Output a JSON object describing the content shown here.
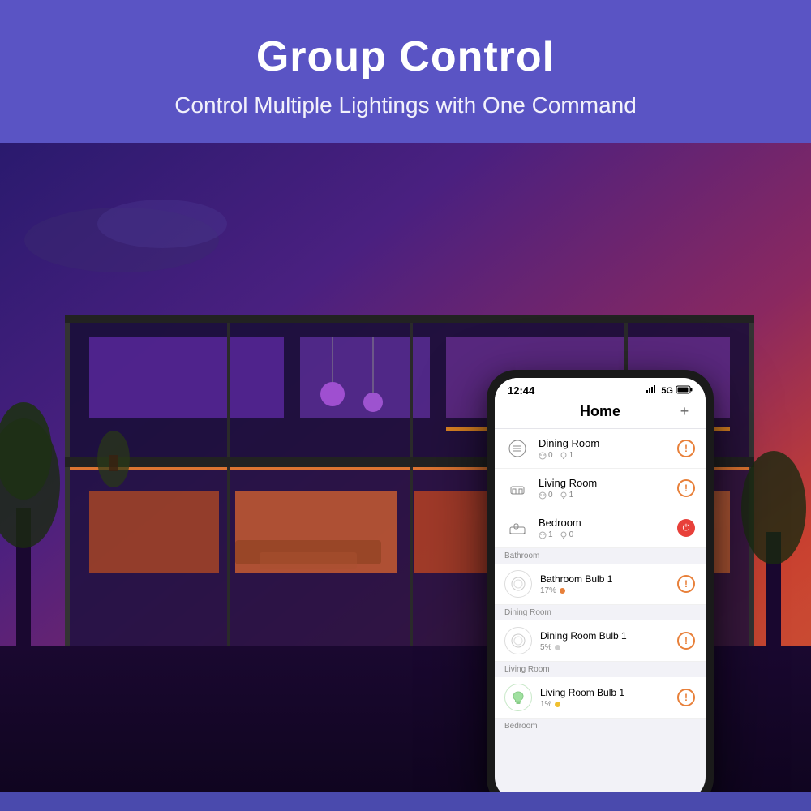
{
  "header": {
    "title": "Group Control",
    "subtitle": "Control Multiple Lightings with One Command"
  },
  "phone": {
    "status_bar": {
      "time": "12:44",
      "signal": "▪▪▪",
      "network": "5G",
      "battery": "▮"
    },
    "app_title": "Home",
    "add_button": "+",
    "rooms": [
      {
        "name": "Dining Room",
        "icon": "🍽",
        "plugs": 0,
        "bulbs": 1,
        "status": "alert"
      },
      {
        "name": "Living Room",
        "icon": "🛋",
        "plugs": 0,
        "bulbs": 1,
        "status": "alert"
      },
      {
        "name": "Bedroom",
        "icon": "🛏",
        "plugs": 1,
        "bulbs": 0,
        "status": "power"
      }
    ],
    "sections": [
      {
        "label": "Bathroom",
        "devices": [
          {
            "name": "Bathroom Bulb 1",
            "percent": "17%",
            "dot_color": "orange",
            "status": "alert",
            "icon": "bulb-ring"
          }
        ]
      },
      {
        "label": "Dining Room",
        "devices": [
          {
            "name": "Dining Room Bulb 1",
            "percent": "5%",
            "dot_color": "gray",
            "status": "alert",
            "icon": "bulb-ring"
          }
        ]
      },
      {
        "label": "Living Room",
        "devices": [
          {
            "name": "Living Room Bulb 1",
            "percent": "1%",
            "dot_color": "yellow",
            "status": "alert",
            "icon": "bulb-color"
          }
        ]
      },
      {
        "label": "Bedroom",
        "devices": []
      }
    ]
  },
  "colors": {
    "header_bg": "#5a54c4",
    "alert_color": "#e8803a",
    "power_color": "#e8403a",
    "dot_orange": "#e8803a",
    "dot_gray": "#cccccc",
    "dot_yellow": "#f0c030"
  }
}
